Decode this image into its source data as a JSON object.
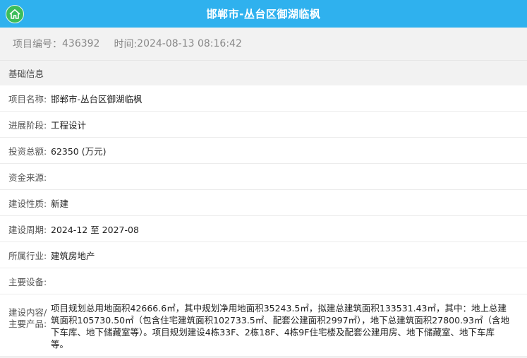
{
  "header": {
    "title": "邯郸市-丛台区御湖临枫"
  },
  "meta": {
    "project_no_label": "项目编号：",
    "project_no": "436392",
    "time_label": "时间: ",
    "time": "2024-08-13 08:16:42"
  },
  "section": {
    "title": "基础信息"
  },
  "fields": {
    "name": {
      "label": "项目名称:",
      "value": "邯郸市-丛台区御湖临枫"
    },
    "stage": {
      "label": "进展阶段:",
      "value": "工程设计"
    },
    "investment": {
      "label": "投资总额:",
      "value": "62350 (万元)"
    },
    "funding": {
      "label": "资金来源:",
      "value": ""
    },
    "nature": {
      "label": "建设性质:",
      "value": "新建"
    },
    "period": {
      "label": "建设周期:",
      "value": "2024-12 至 2027-08"
    },
    "industry": {
      "label": "所属行业:",
      "value": "建筑房地产"
    },
    "equipment": {
      "label": "主要设备:",
      "value": ""
    },
    "content": {
      "label": "建设内容/主要产品:",
      "value": "项目规划总用地面积42666.6㎡，其中规划净用地面积35243.5㎡，拟建总建筑面积133531.43㎡，其中：地上总建筑面积105730.50㎡（包含住宅建筑面积102733.5㎡、配套公建面积2997㎡），地下总建筑面积27800.93㎡（含地下车库、地下储藏室等）。项目规划建设4栋33F、2栋18F、4栋9F住宅楼及配套公建用房、地下储藏室、地下车库等。"
    }
  }
}
